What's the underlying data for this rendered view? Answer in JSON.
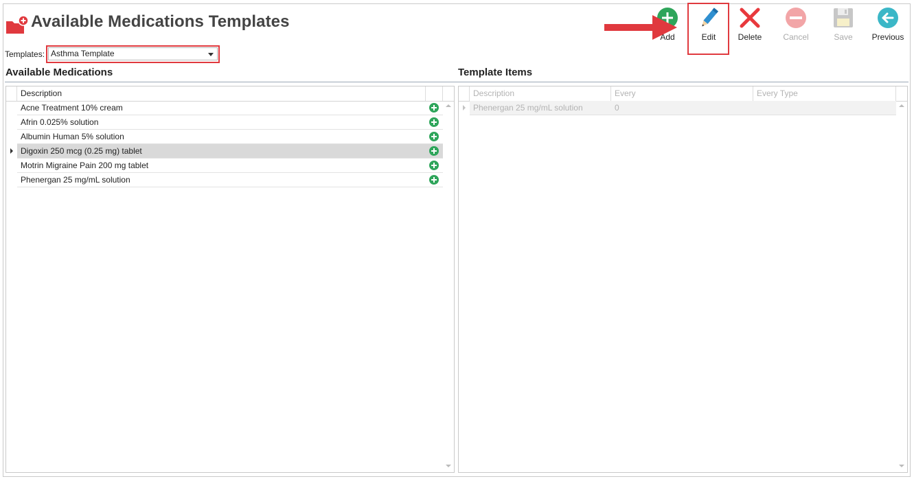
{
  "header": {
    "title": "Available Medications Templates",
    "templates_label": "Templates:",
    "templates_selected": "Asthma Template"
  },
  "toolbar": {
    "add_label": "Add",
    "edit_label": "Edit",
    "delete_label": "Delete",
    "cancel_label": "Cancel",
    "save_label": "Save",
    "previous_label": "Previous"
  },
  "available": {
    "title": "Available Medications",
    "column": "Description",
    "rows": [
      "Acne Treatment 10% cream",
      "Afrin 0.025% solution",
      "Albumin Human 5% solution",
      "Digoxin 250 mcg (0.25 mg) tablet",
      "Motrin Migraine Pain 200 mg tablet",
      "Phenergan 25 mg/mL solution"
    ],
    "selected_index": 3
  },
  "template_items": {
    "title": "Template Items",
    "columns": [
      "Description",
      "Every",
      "Every Type"
    ],
    "rows": [
      {
        "description": "Phenergan 25 mg/mL solution",
        "every": "0",
        "every_type": ""
      }
    ]
  },
  "colors": {
    "add_green": "#2ea55a",
    "edit_blue": "#2f8fd0",
    "delete_red": "#e8393d",
    "previous_teal": "#3bb7c7",
    "highlight_red": "#e0393e"
  }
}
